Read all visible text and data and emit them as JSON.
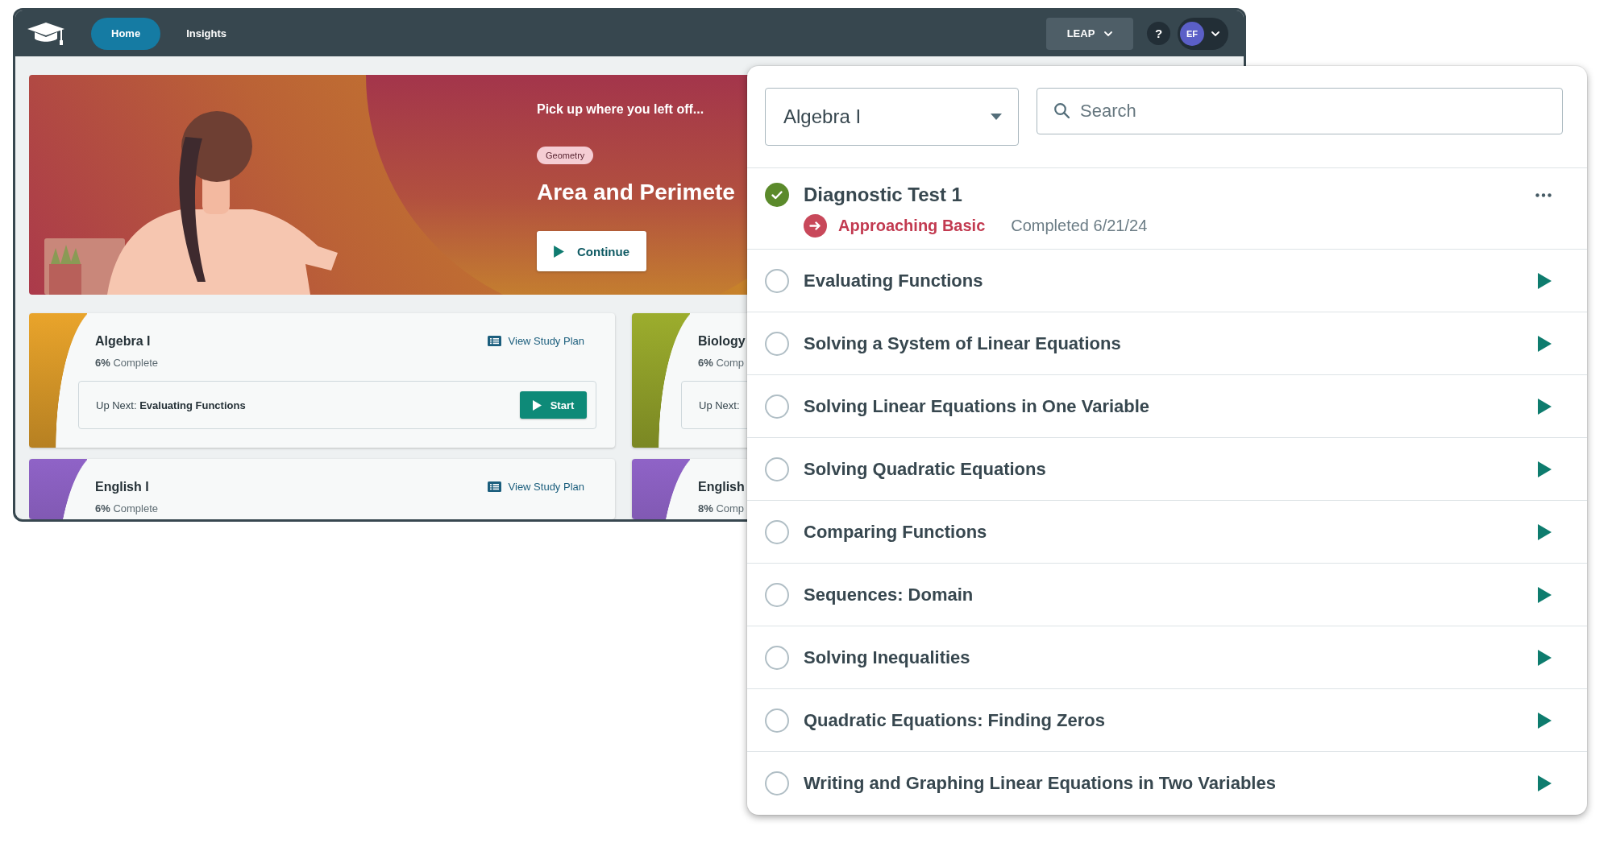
{
  "nav": {
    "tabs": [
      {
        "label": "Home",
        "selected": true
      },
      {
        "label": "Insights",
        "selected": false
      }
    ],
    "program_menu": {
      "label": "LEAP"
    },
    "help": {
      "label": "?"
    },
    "account": {
      "initials": "EF"
    }
  },
  "hero": {
    "intro": "Pick up where you left off...",
    "tag": "Geometry",
    "title": "Area and Perimete",
    "button": "Continue"
  },
  "courses": [
    {
      "name": "Algebra I",
      "color": "#e9a42b",
      "progress": "**6%** Complete",
      "link": "View Study Plan",
      "up_next": "Up Next: **Evaluating Functions**",
      "button": "Start"
    },
    {
      "name": "Biology",
      "color": "#9cad2d",
      "progress": "**6%** Comp",
      "up_next": "Up Next:"
    },
    {
      "name": "English I",
      "color": "#8f63c7",
      "progress": "**6%** Complete",
      "link": "View Study Plan"
    },
    {
      "name": "English",
      "color": "#8f63c7",
      "progress": "**8%** Comp"
    }
  ],
  "study_panel": {
    "course_select": {
      "value": "Algebra I"
    },
    "search": {
      "placeholder": "Search"
    },
    "items": [
      {
        "kind": "assessment",
        "title": "Diagnostic Test 1",
        "completed": true,
        "result": "Approaching Basic",
        "status": "Completed 6/21/24"
      },
      {
        "kind": "lesson",
        "title": "Evaluating Functions",
        "completed": false
      },
      {
        "kind": "lesson",
        "title": "Solving a System of Linear Equations",
        "completed": false
      },
      {
        "kind": "lesson",
        "title": "Solving Linear Equations in One Variable",
        "completed": false
      },
      {
        "kind": "lesson",
        "title": "Solving Quadratic Equations",
        "completed": false
      },
      {
        "kind": "lesson",
        "title": "Comparing Functions",
        "completed": false
      },
      {
        "kind": "lesson",
        "title": "Sequences: Domain",
        "completed": false
      },
      {
        "kind": "lesson",
        "title": "Solving Inequalities",
        "completed": false
      },
      {
        "kind": "lesson",
        "title": "Quadratic Equations: Finding Zeros",
        "completed": false
      },
      {
        "kind": "lesson",
        "title": "Writing and Graphing Linear Equations in Two Variables",
        "completed": false
      }
    ]
  }
}
